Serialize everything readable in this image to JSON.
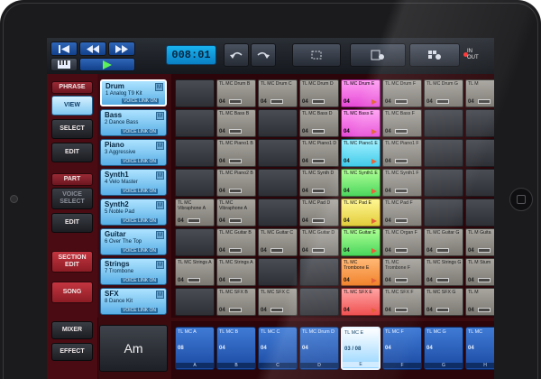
{
  "toolbar": {
    "time": "008:01",
    "in_out": [
      "IN",
      "OUT"
    ],
    "icons": [
      "skip-to-start-icon",
      "rewind-icon",
      "fast-forward-icon",
      "keyboard-icon",
      "play-icon",
      "undo-icon",
      "redo-icon",
      "select-box-icon",
      "settings-menu-icon",
      "grid-settings-icon"
    ]
  },
  "left_panel": {
    "phrase": "PHRASE",
    "view": "VIEW",
    "select": "SELECT",
    "edit1": "EDIT",
    "part": "PART",
    "voice_select": "VOICE SELECT",
    "edit2": "EDIT",
    "section_edit": "SECTION EDIT",
    "song": "SONG",
    "mixer": "MIXER",
    "effect": "EFFECT"
  },
  "tracks": [
    {
      "name": "Drum",
      "num": "1",
      "sub": "Analog T9 Kit",
      "link": "VOICE LINK ON"
    },
    {
      "name": "Bass",
      "num": "2",
      "sub": "Dance Bass",
      "link": "VOICE LINK ON"
    },
    {
      "name": "Piano",
      "num": "3",
      "sub": "Aggressive",
      "link": "VOICE LINK ON"
    },
    {
      "name": "Synth1",
      "num": "4",
      "sub": "Velo Master",
      "link": "VOICE LINK ON"
    },
    {
      "name": "Synth2",
      "num": "5",
      "sub": "Noble Pad",
      "link": "VOICE LINK ON"
    },
    {
      "name": "Guitar",
      "num": "6",
      "sub": "Over The Top",
      "link": "VOICE LINK ON"
    },
    {
      "name": "Strings",
      "num": "7",
      "sub": "Trombone",
      "link": "VOICE LINK ON"
    },
    {
      "name": "SFX",
      "num": "8",
      "sub": "Dance Kit",
      "link": "VOICE LINK ON"
    }
  ],
  "mute_label": "M",
  "chord": "Am",
  "grid": [
    [
      {
        "t": "e"
      },
      {
        "t": "c",
        "name": "TL MC Drum B",
        "len": "04"
      },
      {
        "t": "c",
        "name": "TL MC Drum C",
        "len": "04"
      },
      {
        "t": "c",
        "name": "TL MC Drum D",
        "len": "04"
      },
      {
        "t": "pink",
        "name": "TL MC Drum E",
        "len": "04",
        "play": true
      },
      {
        "t": "c",
        "name": "TL MC Drum F",
        "len": "04"
      },
      {
        "t": "c",
        "name": "TL MC Drum G",
        "len": "04"
      },
      {
        "t": "c",
        "name": "TL M",
        "len": "04"
      }
    ],
    [
      {
        "t": "e"
      },
      {
        "t": "c",
        "name": "TL MC Bass B",
        "len": "04"
      },
      {
        "t": "e"
      },
      {
        "t": "c",
        "name": "TL MC Bass D",
        "len": "04"
      },
      {
        "t": "pink",
        "name": "TL MC Bass E",
        "len": "04",
        "play": true
      },
      {
        "t": "c",
        "name": "TL MC Bass F",
        "len": "04"
      },
      {
        "t": "e"
      },
      {
        "t": "e"
      }
    ],
    [
      {
        "t": "e"
      },
      {
        "t": "c",
        "name": "TL MC Piano1 B",
        "len": "04"
      },
      {
        "t": "e"
      },
      {
        "t": "c",
        "name": "TL MC Piano1 D",
        "len": "04"
      },
      {
        "t": "cyan",
        "name": "TL MC Piano1 E",
        "len": "04",
        "play": true
      },
      {
        "t": "c",
        "name": "TL MC Piano1 F",
        "len": "04"
      },
      {
        "t": "e"
      },
      {
        "t": "e"
      }
    ],
    [
      {
        "t": "e"
      },
      {
        "t": "c",
        "name": "TL MC Piano2 B",
        "len": "04"
      },
      {
        "t": "e"
      },
      {
        "t": "c",
        "name": "TL MC Synth D",
        "len": "04"
      },
      {
        "t": "green",
        "name": "TL MC Synth1 E",
        "len": "04",
        "play": true
      },
      {
        "t": "c",
        "name": "TL MC Synth1 F",
        "len": "04"
      },
      {
        "t": "e"
      },
      {
        "t": "e"
      }
    ],
    [
      {
        "t": "c",
        "name": "TL MC Vibraphone A",
        "len": "04"
      },
      {
        "t": "c",
        "name": "TL MC Vibraphone A",
        "len": "04"
      },
      {
        "t": "e"
      },
      {
        "t": "c",
        "name": "TL MC Pad D",
        "len": "04"
      },
      {
        "t": "yellow",
        "name": "TL MC Pad E",
        "len": "04",
        "play": true
      },
      {
        "t": "c",
        "name": "TL MC Pad F",
        "len": "04"
      },
      {
        "t": "e"
      },
      {
        "t": "e"
      }
    ],
    [
      {
        "t": "e"
      },
      {
        "t": "c",
        "name": "TL MC Guitar B",
        "len": "04"
      },
      {
        "t": "c",
        "name": "TL MC Guitar C",
        "len": "04"
      },
      {
        "t": "c",
        "name": "TL MC Guitar D",
        "len": "04"
      },
      {
        "t": "green",
        "name": "TL MC Guitar E",
        "len": "04",
        "play": true
      },
      {
        "t": "c",
        "name": "TL MC Organ F",
        "len": "04"
      },
      {
        "t": "c",
        "name": "TL MC Guitar G",
        "len": "04"
      },
      {
        "t": "c",
        "name": "TL M Guita",
        "len": "04"
      }
    ],
    [
      {
        "t": "c",
        "name": "TL MC Strings A",
        "len": "04"
      },
      {
        "t": "c",
        "name": "TL MC Strings A",
        "len": "04"
      },
      {
        "t": "e"
      },
      {
        "t": "e"
      },
      {
        "t": "orange",
        "name": "TL MC Trombone E",
        "len": "04",
        "play": true
      },
      {
        "t": "c",
        "name": "TL MC Trombone F",
        "len": "04"
      },
      {
        "t": "c",
        "name": "TL MC Strings G",
        "len": "04"
      },
      {
        "t": "c",
        "name": "TL M Stum",
        "len": "04"
      }
    ],
    [
      {
        "t": "e"
      },
      {
        "t": "c",
        "name": "TL MC SFX B",
        "len": "04"
      },
      {
        "t": "c",
        "name": "TL MC SFX C",
        "len": "04"
      },
      {
        "t": "e"
      },
      {
        "t": "red",
        "name": "TL MC SFX E",
        "len": "04",
        "play": true
      },
      {
        "t": "c",
        "name": "TL MC SFX F",
        "len": "04"
      },
      {
        "t": "c",
        "name": "TL MC SFX G",
        "len": "04"
      },
      {
        "t": "c",
        "name": "TL M",
        "len": "04"
      }
    ]
  ],
  "scenes": [
    {
      "name": "TL MC A",
      "len": "08",
      "letter": "A"
    },
    {
      "name": "TL MC B",
      "len": "04",
      "letter": "B"
    },
    {
      "name": "TL MC C",
      "len": "04",
      "letter": "C"
    },
    {
      "name": "TL MC Drum D",
      "len": "04",
      "letter": "D"
    },
    {
      "name": "TL MC E",
      "len": "03 / 08",
      "letter": "E",
      "active": true
    },
    {
      "name": "TL MC F",
      "len": "04",
      "letter": "F"
    },
    {
      "name": "TL MC G",
      "len": "04",
      "letter": "G"
    },
    {
      "name": "TL MC",
      "len": "04",
      "letter": "H"
    }
  ]
}
